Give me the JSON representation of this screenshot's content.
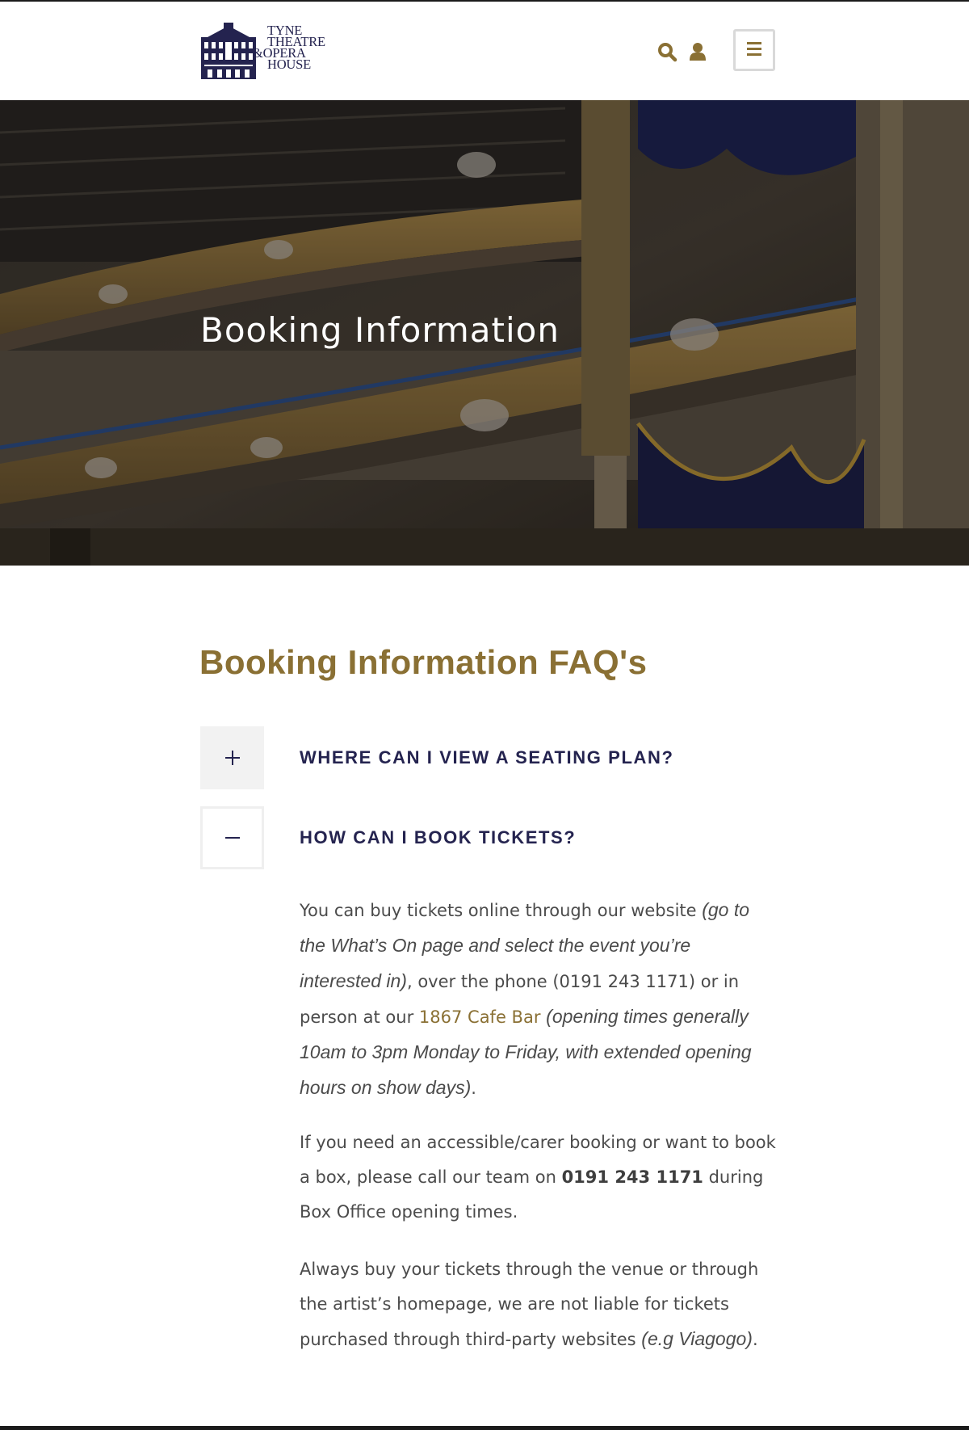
{
  "header": {
    "logo_lines": [
      "TYNE",
      "THEATRE",
      "&OPERA",
      "HOUSE"
    ],
    "icons": [
      "search-icon",
      "user-icon",
      "menu-icon"
    ]
  },
  "hero": {
    "title": "Booking Information"
  },
  "faq": {
    "heading": "Booking Information FAQ's",
    "items": [
      {
        "question": "WHERE CAN I VIEW A SEATING PLAN?",
        "toggle": "+",
        "state": "collapsed"
      },
      {
        "question": "HOW CAN I BOOK TICKETS?",
        "toggle": "−",
        "state": "expanded"
      }
    ],
    "answer": {
      "p1_a": "You can buy tickets online through our website ",
      "p1_b": "(go to the What’s On page and select the event you’re interested in)",
      "p1_c": ", over the phone (0191 243 1171) or in person at our ",
      "p1_link": "1867 Cafe Bar",
      "p1_d": " ",
      "p1_e": "(opening times generally 10am to 3pm Monday to Friday, with extended opening hours on show days)",
      "p1_f": ".",
      "p2_a": "If you need an accessible/carer booking or want to book a box, please call our team on ",
      "p2_b": "0191 243 1171",
      "p2_c": " during Box Office opening times.",
      "p3_a": "Always buy your tickets through the venue or through the artist’s homepage, we are not liable for tickets purchased through third-party websites ",
      "p3_b": "(e.g Viagogo)",
      "p3_c": "."
    }
  },
  "colors": {
    "gold": "#8a7034",
    "navy": "#24234f",
    "text": "#4b4b4b",
    "toggle_bg": "#f2f2f2"
  }
}
